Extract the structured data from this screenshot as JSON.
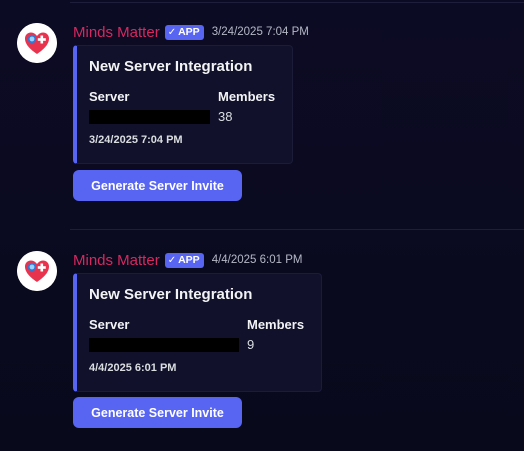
{
  "messages": [
    {
      "author": "Minds Matter",
      "badge": "APP",
      "badge_check": "✓",
      "timestamp": "3/24/2025 7:04 PM",
      "embed": {
        "title": "New Server Integration",
        "server_label": "Server",
        "server_value": "",
        "members_label": "Members",
        "members_value": "38",
        "footer": "3/24/2025 7:04 PM"
      },
      "button_label": "Generate Server Invite"
    },
    {
      "author": "Minds Matter",
      "badge": "APP",
      "badge_check": "✓",
      "timestamp": "4/4/2025 6:01 PM",
      "embed": {
        "title": "New Server Integration",
        "server_label": "Server",
        "server_value": "",
        "members_label": "Members",
        "members_value": "9",
        "footer": "4/4/2025 6:01 PM"
      },
      "button_label": "Generate Server Invite"
    }
  ],
  "colors": {
    "background": "#0b0a20",
    "username": "#d6285f",
    "accent": "#5865f2",
    "embed_bg": "#12112b"
  },
  "icons": {
    "avatar": "brain-heart-logo-icon",
    "badge": "checkmark-icon"
  }
}
